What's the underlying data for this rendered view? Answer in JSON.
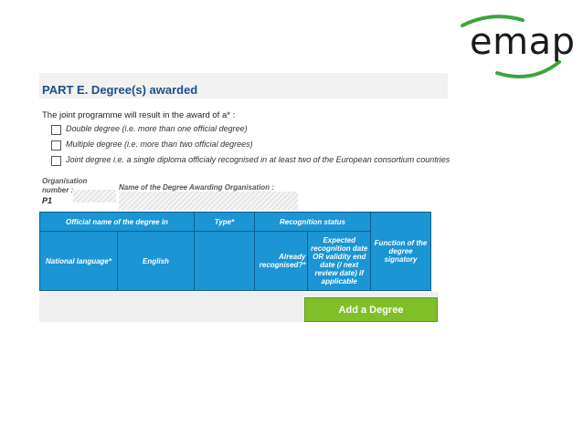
{
  "logo": {
    "text": "emap"
  },
  "part": {
    "title": "PART E.  Degree(s) awarded",
    "question": "The joint programme will result in the award of a* :",
    "options": [
      {
        "label": "Double degree (i.e. more than one official degree)"
      },
      {
        "label": "Multiple degree (i.e. more than two official degrees)"
      },
      {
        "label": "Joint degree i.e. a single diploma officialy recognised in at least two of the European consortium countries"
      }
    ]
  },
  "organisation": {
    "number_label_line1": "Organisation",
    "number_label_line2": "number :",
    "number_value": "P1",
    "name_label": "Name of the Degree Awarding Organisation :"
  },
  "table": {
    "header_row1": {
      "official_name": "Official name of the degree in",
      "type": "Type*",
      "recognition_status": "Recognition status"
    },
    "header_row2": {
      "national_language": "National language*",
      "english": "English",
      "already_recognised": "Already recognised?*",
      "expected_recognition": "Expected recognition date OR validity end date (/ next review date) if applicable",
      "function_signatory": "Function of the degree signatory"
    }
  },
  "actions": {
    "add_degree": "Add a Degree"
  },
  "colors": {
    "table_blue": "#1b95d3",
    "button_green": "#7fbf2a",
    "title_blue": "#1f4e8c",
    "logo_green": "#3aa63a"
  }
}
